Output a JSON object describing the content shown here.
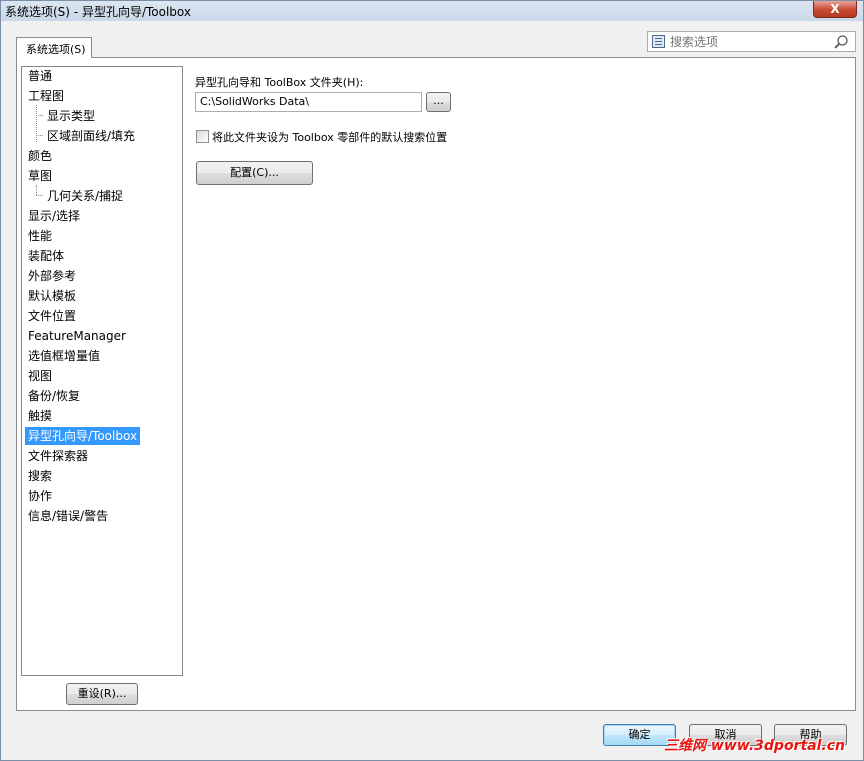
{
  "window": {
    "title": "系统选项(S) - 异型孔向导/Toolbox",
    "close_glyph": "X"
  },
  "tabs": [
    {
      "label": "系统选项(S)"
    }
  ],
  "search": {
    "placeholder": "搜索选项"
  },
  "tree": {
    "items": [
      {
        "label": "普通",
        "level": 0
      },
      {
        "label": "工程图",
        "level": 0
      },
      {
        "label": "显示类型",
        "level": 1
      },
      {
        "label": "区域剖面线/填充",
        "level": 1
      },
      {
        "label": "颜色",
        "level": 0
      },
      {
        "label": "草图",
        "level": 0
      },
      {
        "label": "几何关系/捕捉",
        "level": 1
      },
      {
        "label": "显示/选择",
        "level": 0
      },
      {
        "label": "性能",
        "level": 0
      },
      {
        "label": "装配体",
        "level": 0
      },
      {
        "label": "外部参考",
        "level": 0
      },
      {
        "label": "默认模板",
        "level": 0
      },
      {
        "label": "文件位置",
        "level": 0
      },
      {
        "label": "FeatureManager",
        "level": 0
      },
      {
        "label": "选值框增量值",
        "level": 0
      },
      {
        "label": "视图",
        "level": 0
      },
      {
        "label": "备份/恢复",
        "level": 0
      },
      {
        "label": "触摸",
        "level": 0
      },
      {
        "label": "异型孔向导/Toolbox",
        "level": 0,
        "selected": true
      },
      {
        "label": "文件探索器",
        "level": 0
      },
      {
        "label": "搜索",
        "level": 0
      },
      {
        "label": "协作",
        "level": 0
      },
      {
        "label": "信息/错误/警告",
        "level": 0
      }
    ]
  },
  "reset_button": {
    "label": "重设(R)..."
  },
  "content": {
    "folder_label": "异型孔向导和 ToolBox 文件夹(H):",
    "folder_path": "C:\\SolidWorks Data\\",
    "browse_label": "...",
    "checkbox_label": "将此文件夹设为 Toolbox 零部件的默认搜索位置",
    "checkbox_checked": false,
    "configure_label": "配置(C)..."
  },
  "footer": {
    "ok_label": "确定",
    "cancel_label": "取消",
    "help_label": "帮助"
  },
  "watermark": {
    "text": "三维网 www.3dportal.cn",
    "color": "#e8150f"
  },
  "colors": {
    "selection": "#3399ff"
  }
}
